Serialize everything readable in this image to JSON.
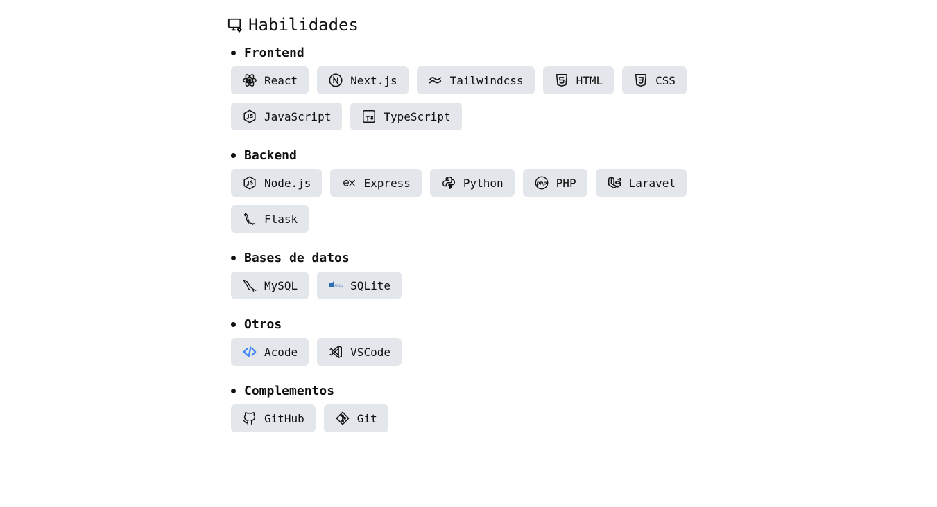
{
  "page": {
    "title": "Habilidades",
    "title_icon": "computer-settings-icon"
  },
  "sections": [
    {
      "id": "frontend",
      "title": "Frontend",
      "skills": [
        {
          "label": "React",
          "icon": "react-icon"
        },
        {
          "label": "Next.js",
          "icon": "nextjs-icon"
        },
        {
          "label": "Tailwindcss",
          "icon": "tailwind-icon"
        },
        {
          "label": "HTML",
          "icon": "html5-icon"
        },
        {
          "label": "CSS",
          "icon": "css3-icon"
        },
        {
          "label": "JavaScript",
          "icon": "javascript-icon"
        },
        {
          "label": "TypeScript",
          "icon": "typescript-icon"
        }
      ]
    },
    {
      "id": "backend",
      "title": "Backend",
      "skills": [
        {
          "label": "Node.js",
          "icon": "nodejs-icon"
        },
        {
          "label": "Express",
          "icon": "express-icon"
        },
        {
          "label": "Python",
          "icon": "python-icon"
        },
        {
          "label": "PHP",
          "icon": "php-icon"
        },
        {
          "label": "Laravel",
          "icon": "laravel-icon"
        },
        {
          "label": "Flask",
          "icon": "flask-icon"
        }
      ]
    },
    {
      "id": "databases",
      "title": "Bases de datos",
      "skills": [
        {
          "label": "MySQL",
          "icon": "mysql-icon"
        },
        {
          "label": "SQLite",
          "icon": "sqlite-icon"
        }
      ]
    },
    {
      "id": "others",
      "title": "Otros",
      "skills": [
        {
          "label": "Acode",
          "icon": "acode-icon"
        },
        {
          "label": "VSCode",
          "icon": "vscode-icon"
        }
      ]
    },
    {
      "id": "complements",
      "title": "Complementos",
      "skills": [
        {
          "label": "GitHub",
          "icon": "github-icon"
        },
        {
          "label": "Git",
          "icon": "git-icon"
        }
      ]
    }
  ],
  "colors": {
    "chip_background": "#e3e6ea",
    "text": "#111111",
    "acode_accent": "#3b82f6",
    "sqlite_accent": "#2f6db3"
  }
}
